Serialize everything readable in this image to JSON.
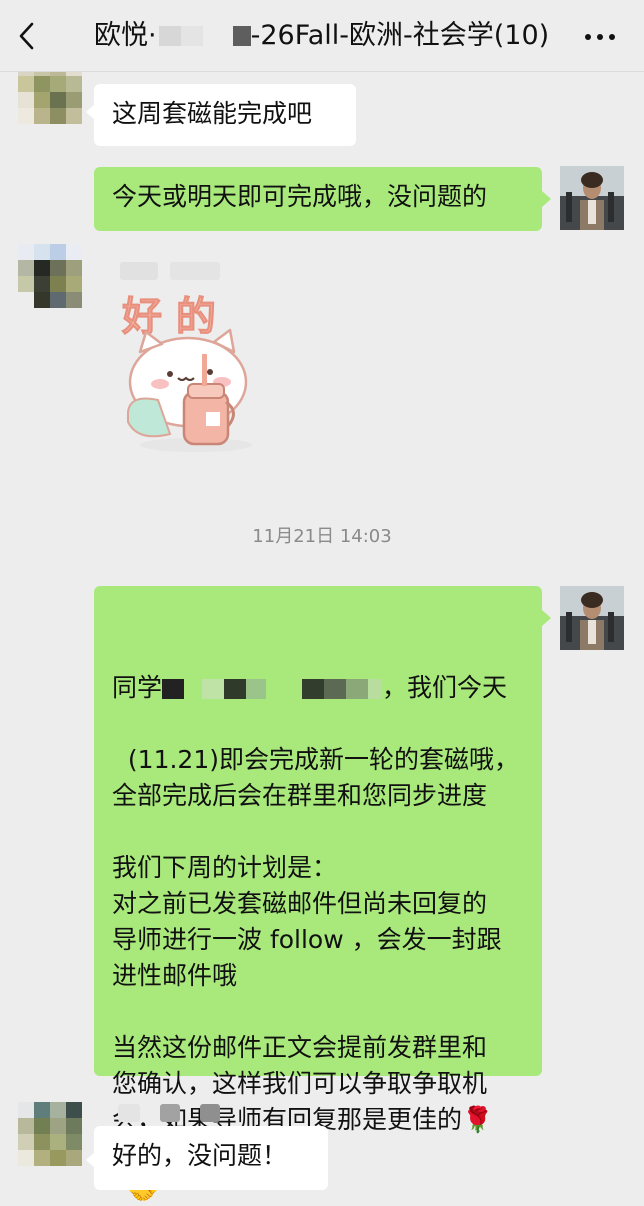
{
  "header": {
    "title_part1": "欧悦·",
    "title_part2": "-26Fall-欧洲-社会学(10)",
    "back_icon": "chevron-left-icon",
    "more_icon": "more-dots-icon"
  },
  "messages": {
    "m1": "这周套磁能完成吧",
    "m2": "今天或明天即可完成哦，没问题的",
    "sticker_text": "好 的",
    "timestamp": "11月21日 14:03",
    "m4_prefix": "同学",
    "m4_after_name": "，我们今天",
    "m4_rest": "(11.21)即会完成新一轮的套磁哦，\n全部完成后会在群里和您同步进度\n\n我们下周的计划是：\n对之前已发套磁邮件但尚未回复的\n导师进行一波 follow ，会发一封跟\n进性邮件哦\n\n当然这份邮件正文会提前发群里和\n您确认，这样我们可以争取争取机\n会，如果导师有回复那是更佳的",
    "m4_emoji_rose": "🌹",
    "m4_emoji_handshake": "🤝",
    "m5": "好的，没问题！"
  },
  "colors": {
    "background": "#ededed",
    "bubble_green": "#a9e97c",
    "bubble_white": "#ffffff"
  }
}
